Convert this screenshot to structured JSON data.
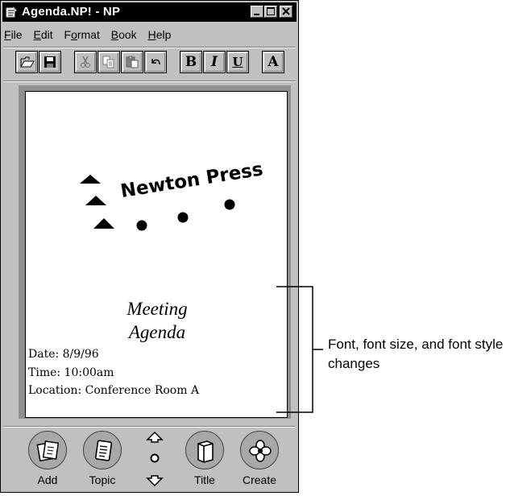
{
  "window": {
    "title": "Agenda.NP! - NP"
  },
  "menu": {
    "items": [
      {
        "label": "File",
        "access": "F",
        "rest": "ile"
      },
      {
        "label": "Edit",
        "access": "E",
        "rest": "dit"
      },
      {
        "label": "Format",
        "access": "o",
        "pre": "F",
        "rest": "rmat"
      },
      {
        "label": "Book",
        "access": "B",
        "rest": "ook"
      },
      {
        "label": "Help",
        "access": "H",
        "rest": "elp"
      }
    ]
  },
  "toolbar": {
    "bold_label": "B",
    "italic_label": "I",
    "underline_label": "U",
    "font_label": "A"
  },
  "document": {
    "company": "Newton Press",
    "heading_line1": "Meeting",
    "heading_line2": "Agenda",
    "date_line": "Date: 8/9/96",
    "time_line": "Time: 10:00am",
    "location_line": "Location: Conference Room A"
  },
  "bottom_bar": {
    "add_label": "Add",
    "topic_label": "Topic",
    "title_label": "Title",
    "create_label": "Create"
  },
  "annotation": {
    "text": "Font, font size, and font style changes"
  }
}
